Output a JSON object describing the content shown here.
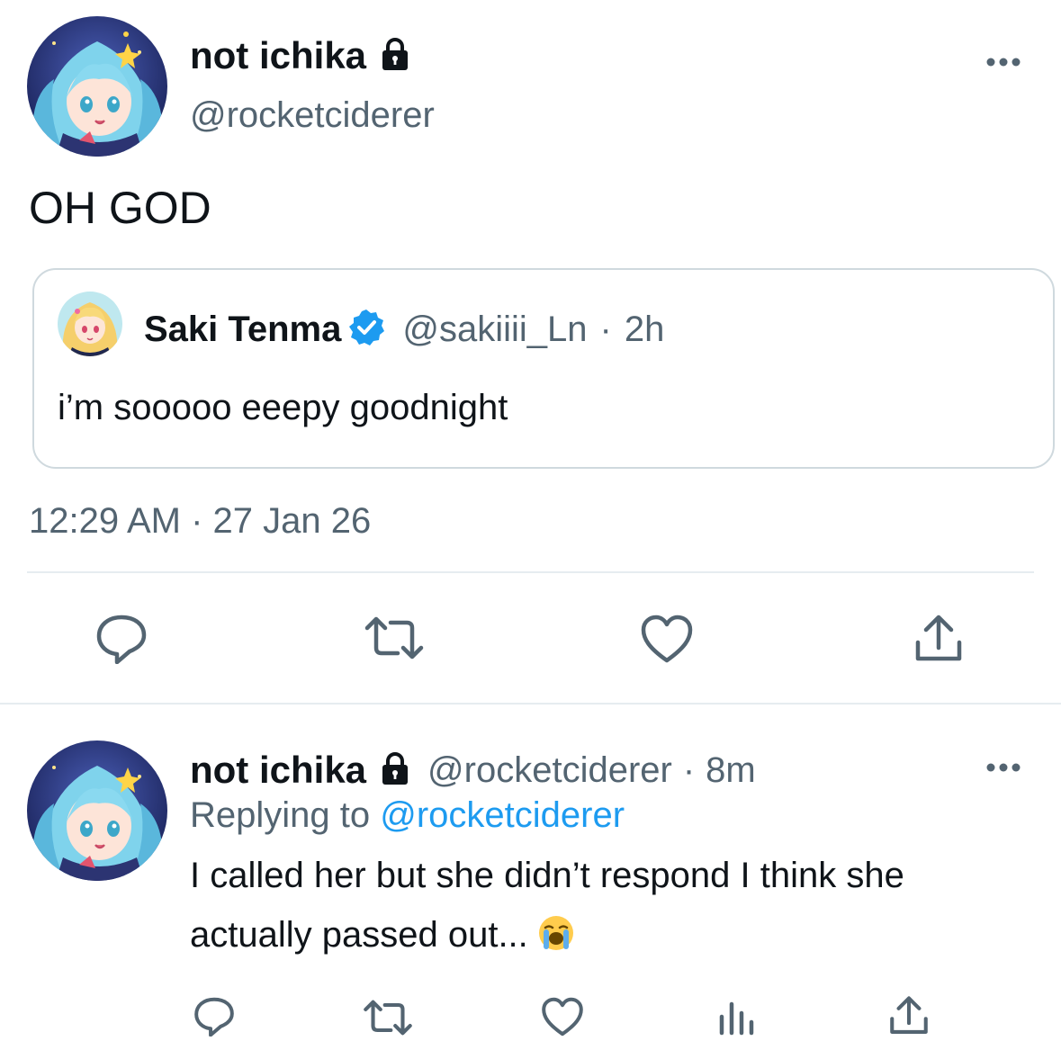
{
  "main_tweet": {
    "author_name": "not ichika",
    "author_handle": "@rocketciderer",
    "text": "OH GOD",
    "quote": {
      "author_name": "Saki Tenma",
      "author_handle": "@sakiiii_Ln",
      "separator": "·",
      "time": "2h",
      "text": "i’m sooooo eeepy goodnight"
    },
    "timestamp": "12:29 AM · 27 Jan 26",
    "actions": [
      "reply-icon",
      "retweet-icon",
      "like-icon",
      "share-icon"
    ]
  },
  "reply_tweet": {
    "author_name": "not ichika",
    "author_handle": "@rocketciderer",
    "separator": "·",
    "time": "8m",
    "replying_to_label": "Replying to",
    "replying_to_handle": "@rocketciderer",
    "text_line1": "I called her but she didn’t respond I think she",
    "text_line2": "actually passed out...",
    "emoji": "loudly-crying-face-icon",
    "actions": [
      "reply-icon",
      "retweet-icon",
      "like-icon",
      "analytics-icon",
      "share-icon"
    ]
  },
  "colors": {
    "text_primary": "#0f1419",
    "text_secondary": "#536471",
    "link": "#1d9bf0",
    "verified": "#1d9bf0",
    "border": "#cfd9de",
    "divider": "#e6ecf0"
  }
}
